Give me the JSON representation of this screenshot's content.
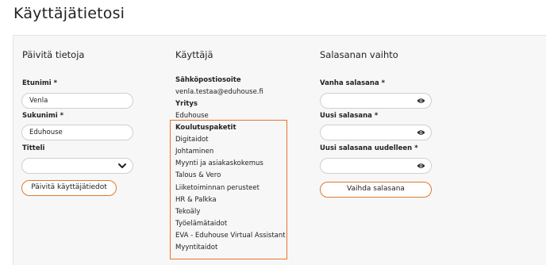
{
  "page": {
    "title": "Käyttäjätietosi"
  },
  "col1": {
    "title": "Päivitä tietoja",
    "first_name_label": "Etunimi *",
    "first_name_value": "Venla",
    "last_name_label": "Sukunimi *",
    "last_name_value": "Eduhouse",
    "title_label": "Titteli",
    "title_value": "",
    "update_button": "Päivitä käyttäjätiedot"
  },
  "col2": {
    "title": "Käyttäjä",
    "email_label": "Sähköpostiosoite",
    "email_value": "venla.testaa@eduhouse.fi",
    "company_label": "Yritys",
    "company_value": "Eduhouse",
    "packages_label": "Koulutuspaketit",
    "packages": [
      "Digitaidot",
      "Johtaminen",
      "Myynti ja asiakaskokemus",
      "Talous & Vero",
      "Liiketoiminnan perusteet",
      "HR & Palkka",
      "Tekoäly",
      "Työelämätaidot",
      "EVA - Eduhouse Virtual Assistant",
      "Myyntitaidot"
    ]
  },
  "col3": {
    "title": "Salasanan vaihto",
    "old_label": "Vanha salasana *",
    "new_label": "Uusi salasana *",
    "repeat_label": "Uusi salasana uudelleen *",
    "change_button": "Vaihda salasana"
  },
  "colors": {
    "accent": "#e8732a",
    "card_bg": "#f7f7f7",
    "text": "#222222"
  },
  "icons": {
    "password_toggle": "eye-icon",
    "select_arrow": "chevron-down-icon"
  }
}
